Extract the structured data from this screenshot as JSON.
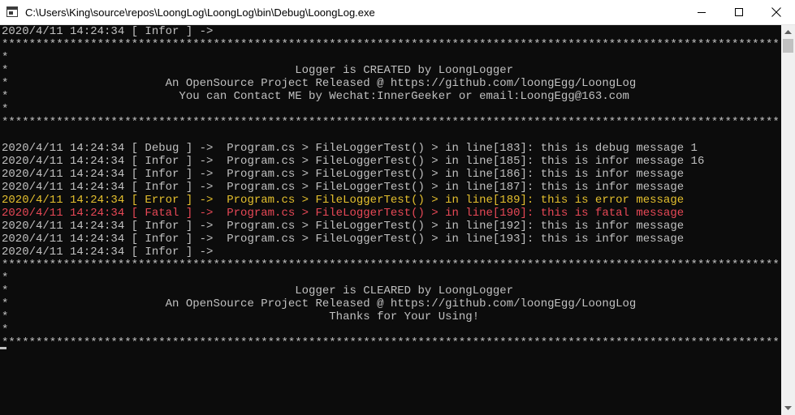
{
  "window": {
    "title": "C:\\Users\\King\\source\\repos\\LoongLog\\LoongLog\\bin\\Debug\\LoongLog.exe",
    "icon": "console-window-icon",
    "controls": [
      "minimize-icon",
      "maximize-icon",
      "close-icon"
    ]
  },
  "colors": {
    "background": "#0c0c0c",
    "text": "#c0c0c0",
    "error": "#e5c02e",
    "fatal": "#e74856"
  },
  "console": {
    "lines": [
      {
        "text": "2020/4/11 14:24:34 [ Infor ] ->",
        "level": "plain"
      },
      {
        "text": "************************************************************************************************************************",
        "level": "plain"
      },
      {
        "text": "*                                                                                                                      *",
        "level": "plain"
      },
      {
        "text": "*                                          Logger is CREATED by LoongLogger                                            *",
        "level": "plain"
      },
      {
        "text": "*                       An OpenSource Project Released @ https://github.com/loongEgg/LoongLog                          *",
        "level": "plain"
      },
      {
        "text": "*                         You can Contact ME by Wechat:InnerGeeker or email:LoongEgg@163.com                           *",
        "level": "plain"
      },
      {
        "text": "*                                                                                                                      *",
        "level": "plain"
      },
      {
        "text": "************************************************************************************************************************",
        "level": "plain"
      },
      {
        "text": "",
        "level": "plain"
      },
      {
        "text": "2020/4/11 14:24:34 [ Debug ] ->  Program.cs > FileLoggerTest() > in line[183]: this is debug message 1",
        "level": "debug"
      },
      {
        "text": "2020/4/11 14:24:34 [ Infor ] ->  Program.cs > FileLoggerTest() > in line[185]: this is infor message 16",
        "level": "infor"
      },
      {
        "text": "2020/4/11 14:24:34 [ Infor ] ->  Program.cs > FileLoggerTest() > in line[186]: this is infor message",
        "level": "infor"
      },
      {
        "text": "2020/4/11 14:24:34 [ Infor ] ->  Program.cs > FileLoggerTest() > in line[187]: this is infor message",
        "level": "infor"
      },
      {
        "text": "2020/4/11 14:24:34 [ Error ] ->  Program.cs > FileLoggerTest() > in line[189]: this is error message",
        "level": "error"
      },
      {
        "text": "2020/4/11 14:24:34 [ Fatal ] ->  Program.cs > FileLoggerTest() > in line[190]: this is fatal message",
        "level": "fatal"
      },
      {
        "text": "2020/4/11 14:24:34 [ Infor ] ->  Program.cs > FileLoggerTest() > in line[192]: this is infor message",
        "level": "infor"
      },
      {
        "text": "2020/4/11 14:24:34 [ Infor ] ->  Program.cs > FileLoggerTest() > in line[193]: this is infor message",
        "level": "infor"
      },
      {
        "text": "2020/4/11 14:24:34 [ Infor ] ->",
        "level": "plain"
      },
      {
        "text": "************************************************************************************************************************",
        "level": "plain"
      },
      {
        "text": "*                                                                                                                      *",
        "level": "plain"
      },
      {
        "text": "*                                          Logger is CLEARED by LoongLogger                                            *",
        "level": "plain"
      },
      {
        "text": "*                       An OpenSource Project Released @ https://github.com/loongEgg/LoongLog                          *",
        "level": "plain"
      },
      {
        "text": "*                                               Thanks for Your Using!                                                 *",
        "level": "plain"
      },
      {
        "text": "*                                                                                                                      *",
        "level": "plain"
      },
      {
        "text": "************************************************************************************************************************",
        "level": "plain"
      }
    ]
  },
  "scrollbar": {
    "up_icon": "scroll-up-arrow-icon",
    "down_icon": "scroll-down-arrow-icon"
  }
}
